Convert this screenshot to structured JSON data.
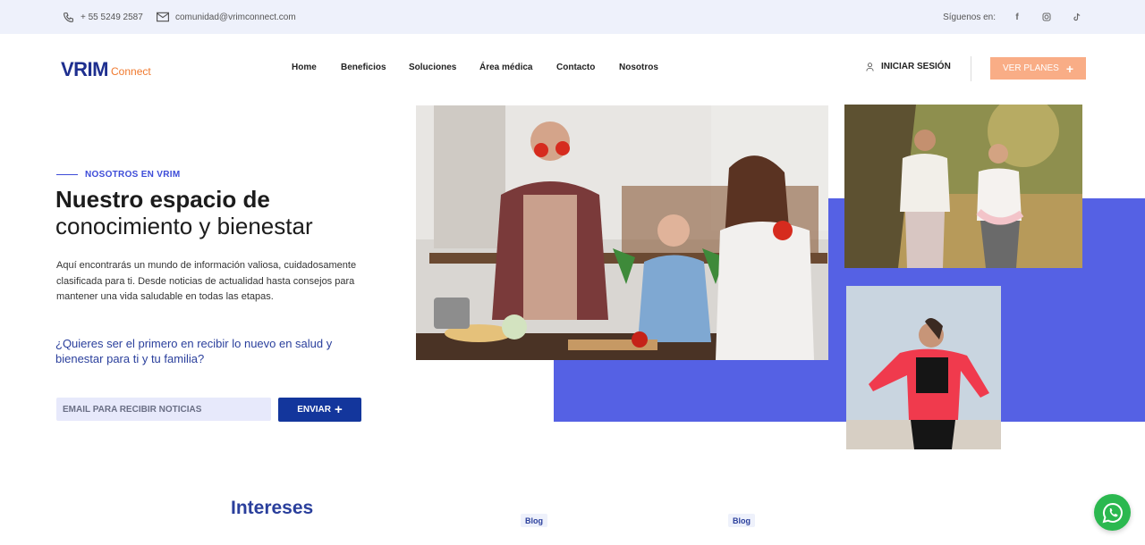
{
  "topbar": {
    "phone": "+ 55 5249 2587",
    "email": "comunidad@vrimconnect.com",
    "follow_label": "Síguenos en:",
    "social_icons": [
      "facebook-icon",
      "instagram-icon",
      "tiktok-icon"
    ]
  },
  "header": {
    "logo_main": "VRIM",
    "logo_sub": "Connect",
    "nav": [
      "Home",
      "Beneficios",
      "Soluciones",
      "Área médica",
      "Contacto",
      "Nosotros"
    ],
    "login_label": "INICIAR SESIÓN",
    "cta_label": "VER PLANES",
    "cta_icon": "plus-icon"
  },
  "hero": {
    "eyebrow": "NOSOTROS EN VRIM",
    "title_line1": "Nuestro espacio de",
    "title_line2": "conocimiento y bienestar",
    "paragraph": "Aquí encontrarás un mundo de información valiosa, cuidadosamente clasificada para ti. Desde noticias de actualidad hasta consejos para mantener una vida saludable en todas las etapas.",
    "question": "¿Quieres ser el primero en recibir lo nuevo en salud y bienestar para ti y tu familia?",
    "email_placeholder": "EMAIL PARA RECIBIR NOTICIAS",
    "send_label": "ENVIAR"
  },
  "section": {
    "title": "Intereses",
    "tags": [
      "Blog",
      "Blog"
    ]
  },
  "colors": {
    "accent_blue": "#5561e4",
    "navy": "#13369c",
    "orange": "#f9ad86",
    "whatsapp_green": "#2bb84f"
  }
}
